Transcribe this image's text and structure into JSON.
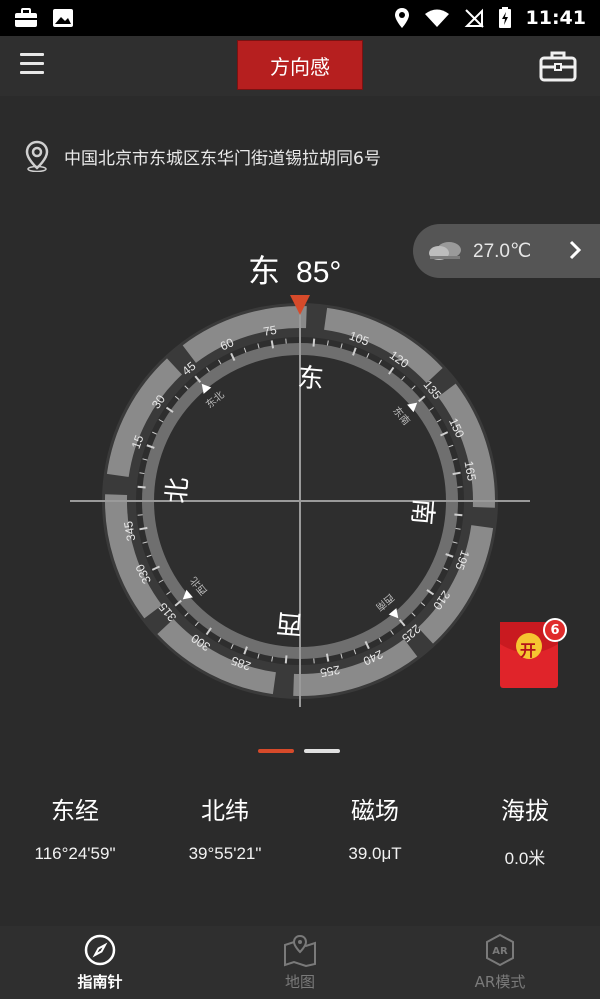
{
  "status_bar": {
    "time": "11:41",
    "icons": [
      "briefcase-icon",
      "image-icon",
      "location-pin-icon",
      "wifi-icon",
      "no-sim-icon",
      "battery-charging-icon"
    ]
  },
  "header": {
    "title": "方向感",
    "menu_icon": "hamburger-menu-icon",
    "toolbox_icon": "toolbox-icon"
  },
  "location": {
    "icon": "location-pin-icon",
    "address": "中国北京市东城区东华门街道锡拉胡同6号"
  },
  "weather": {
    "icon": "cloudy-icon",
    "temperature": "27.0℃"
  },
  "heading": {
    "direction": "东",
    "degrees": "85°",
    "value": 85
  },
  "compass": {
    "cardinals": {
      "north": "北",
      "east": "东",
      "south": "南",
      "west": "西"
    },
    "intercardinals": {
      "northeast": "东北",
      "southeast": "东南",
      "southwest": "西南",
      "northwest": "西北"
    },
    "degree_labels": [
      "15",
      "30",
      "45",
      "60",
      "75",
      "105",
      "120",
      "135",
      "150",
      "165",
      "195",
      "210",
      "225",
      "240",
      "255",
      "285",
      "300",
      "315",
      "330",
      "345"
    ],
    "accent_color": "#d64a2a"
  },
  "red_packet": {
    "label": "开",
    "badge_count": "6"
  },
  "page_indicator": {
    "count": 2,
    "active_index": 0,
    "active_color": "#d64a2a",
    "inactive_color": "#e0e0e0"
  },
  "stats": [
    {
      "label": "东经",
      "value": "116°24'59\""
    },
    {
      "label": "北纬",
      "value": "39°55'21\""
    },
    {
      "label": "磁场",
      "value": "39.0μT"
    },
    {
      "label": "海拔",
      "value": "0.0米"
    }
  ],
  "bottom_nav": [
    {
      "label": "指南针",
      "icon": "compass-icon",
      "active": true
    },
    {
      "label": "地图",
      "icon": "map-icon",
      "active": false
    },
    {
      "label": "AR模式",
      "icon": "ar-icon",
      "active": false
    }
  ]
}
